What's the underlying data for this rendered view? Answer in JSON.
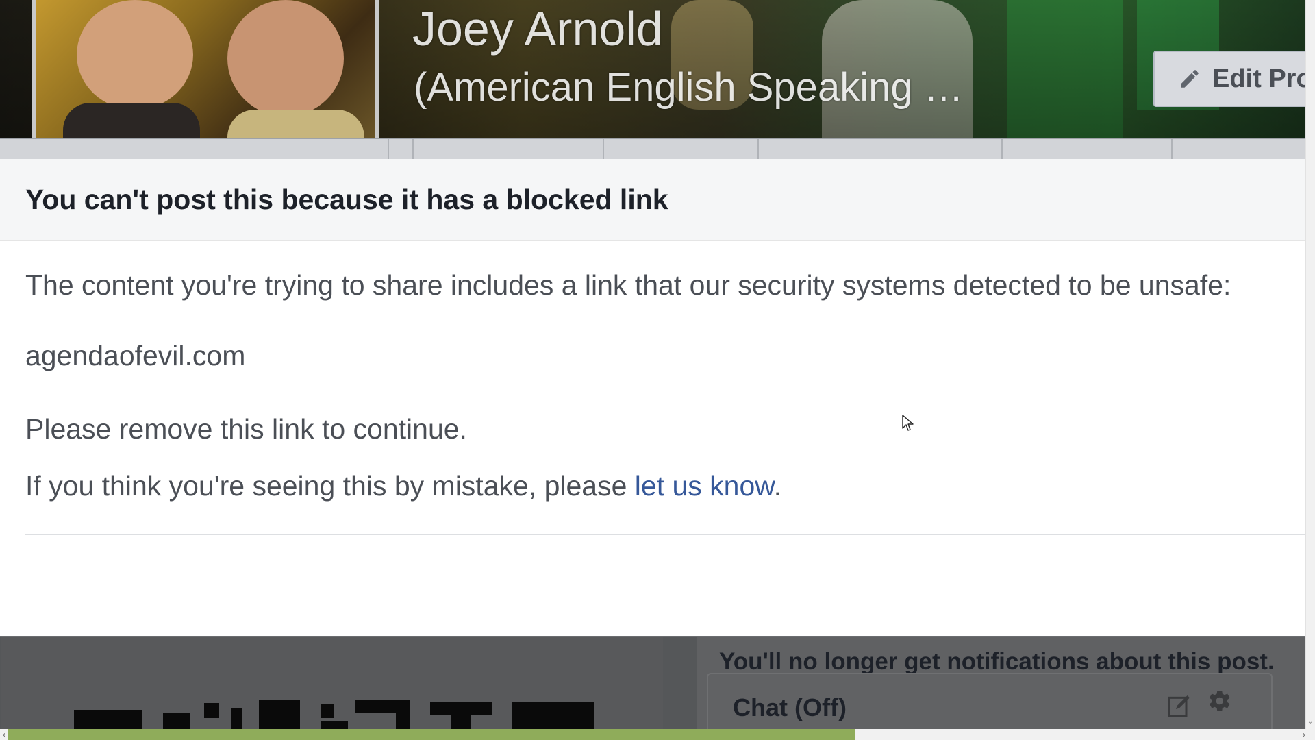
{
  "profile": {
    "name": "Joey Arnold",
    "subtitle": "(American English Speaking …",
    "edit_button_label": "Edit Pro"
  },
  "dialog": {
    "title": "You can't post this because it has a blocked link",
    "intro": "The content you're trying to share includes a link that our security systems detected to be unsafe:",
    "blocked_domain": "agendaofevil.com",
    "instruction": "Please remove this link to continue.",
    "mistake_prefix": "If you think you're seeing this by mistake, please ",
    "mistake_link": "let us know",
    "mistake_suffix": "."
  },
  "background": {
    "notification_text": "You'll no longer get notifications about this post.",
    "chat_label": "Chat (Off)"
  },
  "icons": {
    "edit": "pencil-icon",
    "compose": "compose-icon",
    "settings": "gear-icon"
  },
  "colors": {
    "link": "#365899",
    "dialog_title": "#1d2129",
    "body_text": "#4b4f56",
    "progress": "#8fac5a"
  }
}
